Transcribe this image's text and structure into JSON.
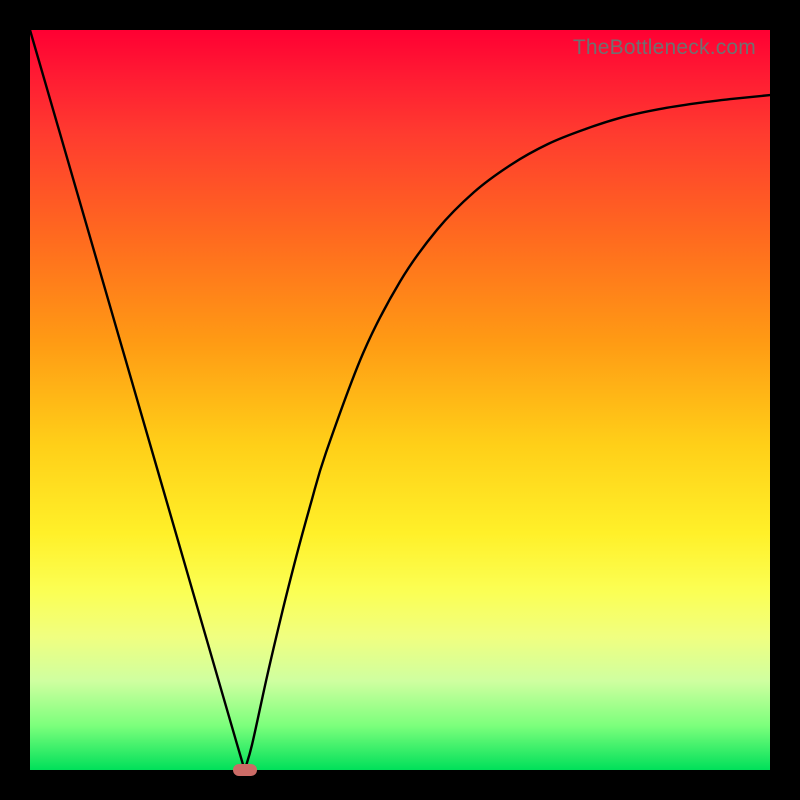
{
  "watermark": "TheBottleneck.com",
  "colors": {
    "frame": "#000000",
    "curve": "#000000",
    "marker": "#cc6b66",
    "gradient_stops": [
      "#ff0033",
      "#ff3b2f",
      "#ff9a14",
      "#fff029",
      "#f0ff80",
      "#00e05a"
    ]
  },
  "chart_data": {
    "type": "line",
    "title": "",
    "xlabel": "",
    "ylabel": "",
    "xlim": [
      0,
      100
    ],
    "ylim": [
      0,
      100
    ],
    "x": [
      0,
      2,
      4,
      6,
      8,
      10,
      12,
      14,
      16,
      18,
      20,
      22,
      24,
      26,
      28,
      29,
      30,
      32,
      34,
      36,
      38,
      40,
      45,
      50,
      55,
      60,
      65,
      70,
      75,
      80,
      85,
      90,
      95,
      100
    ],
    "values": [
      100,
      93.1,
      86.2,
      79.3,
      72.4,
      65.5,
      58.6,
      51.7,
      44.8,
      37.9,
      31.0,
      24.1,
      17.2,
      10.3,
      3.4,
      0,
      3.4,
      12.5,
      21.0,
      28.9,
      36.2,
      42.9,
      56.3,
      66.0,
      73.0,
      78.1,
      81.8,
      84.6,
      86.6,
      88.2,
      89.3,
      90.1,
      90.7,
      91.2
    ],
    "min_marker": {
      "x": 29,
      "y": 0
    },
    "notes": "Axes are unlabeled; values are normalized 0-100 estimates read from the plot. Curve forms a sharp V with minimum near x≈29, left branch linear from top-left, right branch asymptotically rising toward ~91."
  }
}
